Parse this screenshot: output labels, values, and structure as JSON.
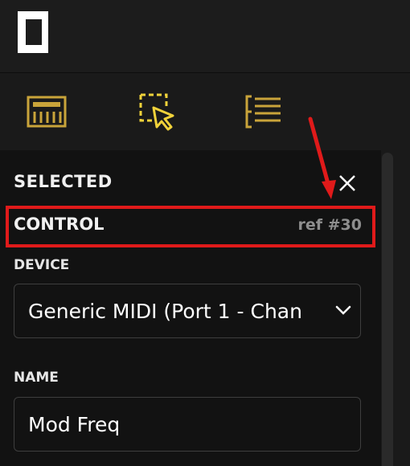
{
  "colors": {
    "accent_gold": "#c9a43a",
    "highlight_yellow": "#f0d23a",
    "annotation_red": "#e01a1a"
  },
  "toolbar": {
    "tools": [
      {
        "icon": "keyboard-icon"
      },
      {
        "icon": "selection-cursor-icon"
      },
      {
        "icon": "list-icon"
      }
    ]
  },
  "panel": {
    "title": "SELECTED",
    "close_icon": "close-icon",
    "control": {
      "label": "CONTROL",
      "ref": "ref #30"
    },
    "device": {
      "label": "DEVICE",
      "value": "Generic MIDI (Port 1 - Chan"
    },
    "name": {
      "label": "NAME",
      "value": "Mod Freq"
    }
  }
}
